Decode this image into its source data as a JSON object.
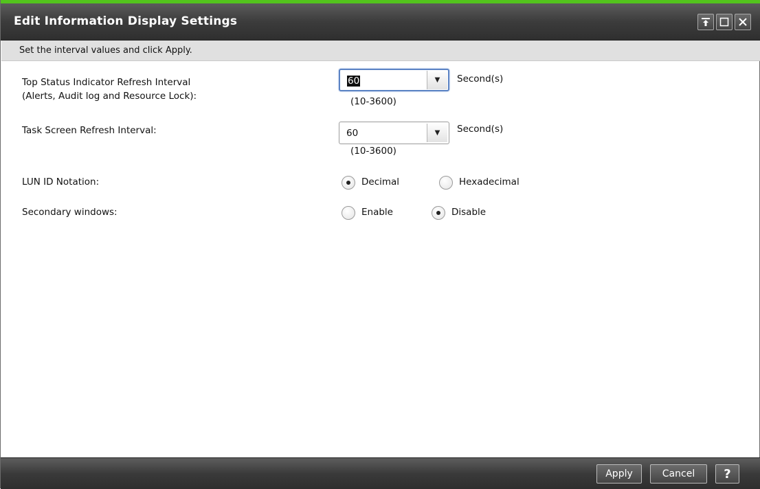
{
  "window": {
    "title": "Edit Information Display Settings",
    "buttons": [
      "pin-icon",
      "maximize-icon",
      "close-icon"
    ]
  },
  "instructions": "Set the interval values and click Apply.",
  "fields": {
    "top_status": {
      "label_line1": "Top Status Indicator Refresh Interval",
      "label_line2": "(Alerts, Audit log and Resource Lock):",
      "value": "60",
      "unit": "Second(s)",
      "range": "(10-3600)"
    },
    "task_screen": {
      "label": "Task Screen Refresh Interval:",
      "value": "60",
      "unit": "Second(s)",
      "range": "(10-3600)"
    },
    "lun_id": {
      "label": "LUN ID Notation:",
      "options": [
        "Decimal",
        "Hexadecimal"
      ],
      "selected": "Decimal"
    },
    "secondary_windows": {
      "label": "Secondary windows:",
      "options": [
        "Enable",
        "Disable"
      ],
      "selected": "Disable"
    }
  },
  "footer": {
    "apply_label": "Apply",
    "cancel_label": "Cancel",
    "help_label": "?"
  },
  "colors": {
    "accent": "#53c41d",
    "titlebar": "#3c3c3c",
    "focus": "#5b83c4"
  }
}
